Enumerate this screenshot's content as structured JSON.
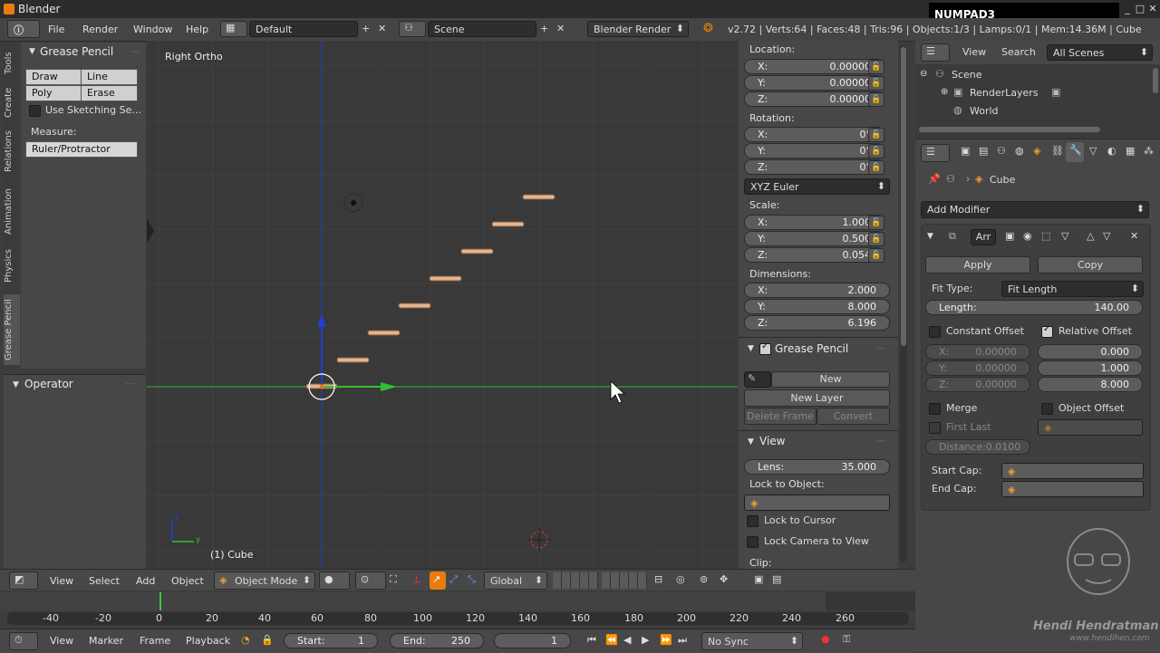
{
  "window": {
    "title": "Blender",
    "overlay_key": "NUMPAD3"
  },
  "info_header": {
    "menus": [
      "File",
      "Render",
      "Window",
      "Help"
    ],
    "screen_layout": "Default",
    "scene": "Scene",
    "render_engine": "Blender Render",
    "stats": "v2.72 | Verts:64 | Faces:48 | Tris:96 | Objects:1/3 | Lamps:0/1 | Mem:14.36M | Cube"
  },
  "tool_tabs": [
    "Tools",
    "Create",
    "Relations",
    "Animation",
    "Physics",
    "Grease Pencil"
  ],
  "toolshelf": {
    "panel_title": "Grease Pencil",
    "draw": "Draw",
    "line": "Line",
    "poly": "Poly",
    "erase": "Erase",
    "use_sketching": "Use Sketching Se...",
    "measure_label": "Measure:",
    "ruler": "Ruler/Protractor"
  },
  "operator": {
    "title": "Operator"
  },
  "viewport": {
    "view_name": "Right Ortho",
    "object_label": "(1) Cube",
    "axis_y": "y",
    "axis_z": "z"
  },
  "npanel": {
    "location_label": "Location:",
    "location": [
      {
        "axis": "X:",
        "value": "0.00000"
      },
      {
        "axis": "Y:",
        "value": "0.00000"
      },
      {
        "axis": "Z:",
        "value": "0.00000"
      }
    ],
    "rotation_label": "Rotation:",
    "rotation": [
      {
        "axis": "X:",
        "value": "0°"
      },
      {
        "axis": "Y:",
        "value": "0°"
      },
      {
        "axis": "Z:",
        "value": "0°"
      }
    ],
    "rotation_mode": "XYZ Euler",
    "scale_label": "Scale:",
    "scale": [
      {
        "axis": "X:",
        "value": "1.000"
      },
      {
        "axis": "Y:",
        "value": "0.500"
      },
      {
        "axis": "Z:",
        "value": "0.054"
      }
    ],
    "dimensions_label": "Dimensions:",
    "dimensions": [
      {
        "axis": "X:",
        "value": "2.000"
      },
      {
        "axis": "Y:",
        "value": "8.000"
      },
      {
        "axis": "Z:",
        "value": "6.196"
      }
    ],
    "gp_panel": "Grease Pencil",
    "gp_new": "New",
    "gp_new_layer": "New Layer",
    "gp_delete_frame": "Delete Frame",
    "gp_convert": "Convert",
    "view_panel": "View",
    "lens_label": "Lens:",
    "lens_value": "35.000",
    "lock_to_object": "Lock to Object:",
    "lock_to_cursor": "Lock to Cursor",
    "lock_camera": "Lock Camera to View",
    "clip": "Clip:"
  },
  "outliner": {
    "view": "View",
    "search": "Search",
    "filter": "All Scenes",
    "items": [
      "Scene",
      "RenderLayers",
      "World"
    ]
  },
  "properties": {
    "context_object": "Cube",
    "add_modifier": "Add Modifier",
    "modifier_name": "Arr",
    "apply": "Apply",
    "copy": "Copy",
    "fit_type_label": "Fit Type:",
    "fit_type": "Fit Length",
    "length_label": "Length:",
    "length_value": "140.00",
    "constant_offset": "Constant Offset",
    "relative_offset": "Relative Offset",
    "const": [
      {
        "axis": "X:",
        "value": "0.00000"
      },
      {
        "axis": "Y:",
        "value": "0.00000"
      },
      {
        "axis": "Z:",
        "value": "0.00000"
      }
    ],
    "rel": [
      "0.000",
      "1.000",
      "8.000"
    ],
    "merge": "Merge",
    "object_offset": "Object Offset",
    "first_last": "First Last",
    "distance": "Distance:0.0100",
    "start_cap": "Start Cap:",
    "end_cap": "End Cap:"
  },
  "viewport_header": {
    "menus": [
      "View",
      "Select",
      "Add",
      "Object"
    ],
    "mode": "Object Mode",
    "orientation": "Global"
  },
  "timeline": {
    "ticks": [
      "-40",
      "-20",
      "0",
      "20",
      "40",
      "60",
      "80",
      "100",
      "120",
      "140",
      "160",
      "180",
      "200",
      "220",
      "240",
      "260"
    ],
    "menus": [
      "View",
      "Marker",
      "Frame",
      "Playback"
    ],
    "start_label": "Start:",
    "start_value": "1",
    "end_label": "End:",
    "end_value": "250",
    "current_frame": "1",
    "sync": "No Sync"
  },
  "watermark": {
    "name": "Hendi Hendratman",
    "site": "www.hendihen.com"
  },
  "colors": {
    "accent": "#e87d0d",
    "y_axis": "#2fbf2f",
    "z_axis": "#2040d0",
    "stair": "#e4b48f"
  }
}
